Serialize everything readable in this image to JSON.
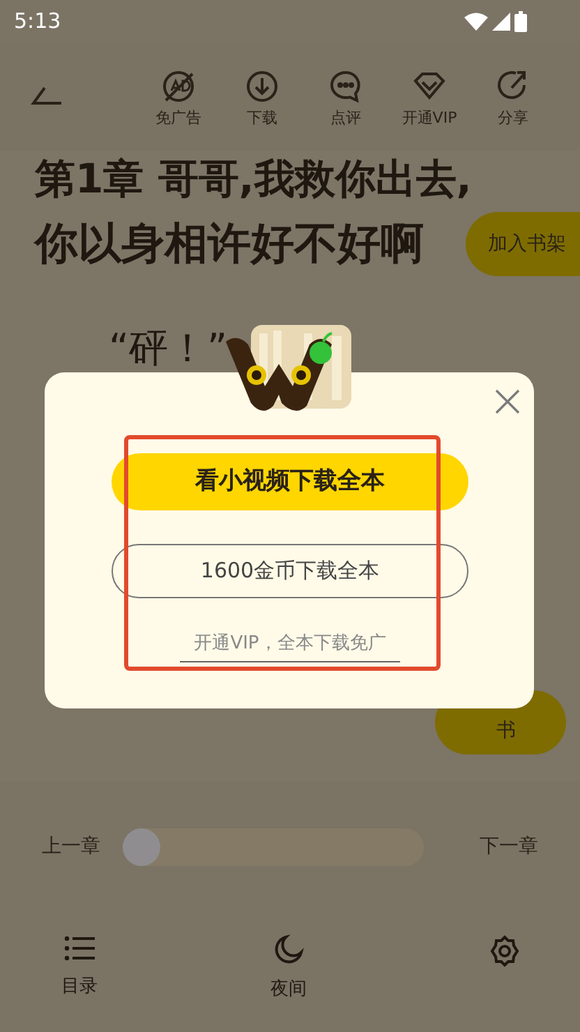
{
  "status_bar": {
    "time": "5:13"
  },
  "toolbar": {
    "actions": [
      {
        "label": "免广告"
      },
      {
        "label": "下载"
      },
      {
        "label": "点评"
      },
      {
        "label": "开通VIP"
      },
      {
        "label": "分享"
      }
    ]
  },
  "reader": {
    "title_line": "第1章 哥哥,我救你出去,",
    "title_line_2": "你以身相许好不好啊",
    "paragraph": "“砰！”",
    "add_to_shelf": "加入书架",
    "listen_button": "书"
  },
  "dialog": {
    "primary_button": "看小视频下载全本",
    "coin_button": "1600金币下载全本",
    "vip_link": "开通VIP，全本下载免广"
  },
  "chapter_nav": {
    "previous": "上一章",
    "next": "下一章",
    "progress": {
      "level": 0
    }
  },
  "bottom_nav": [
    {
      "label": "目录"
    },
    {
      "label": "夜间"
    }
  ]
}
